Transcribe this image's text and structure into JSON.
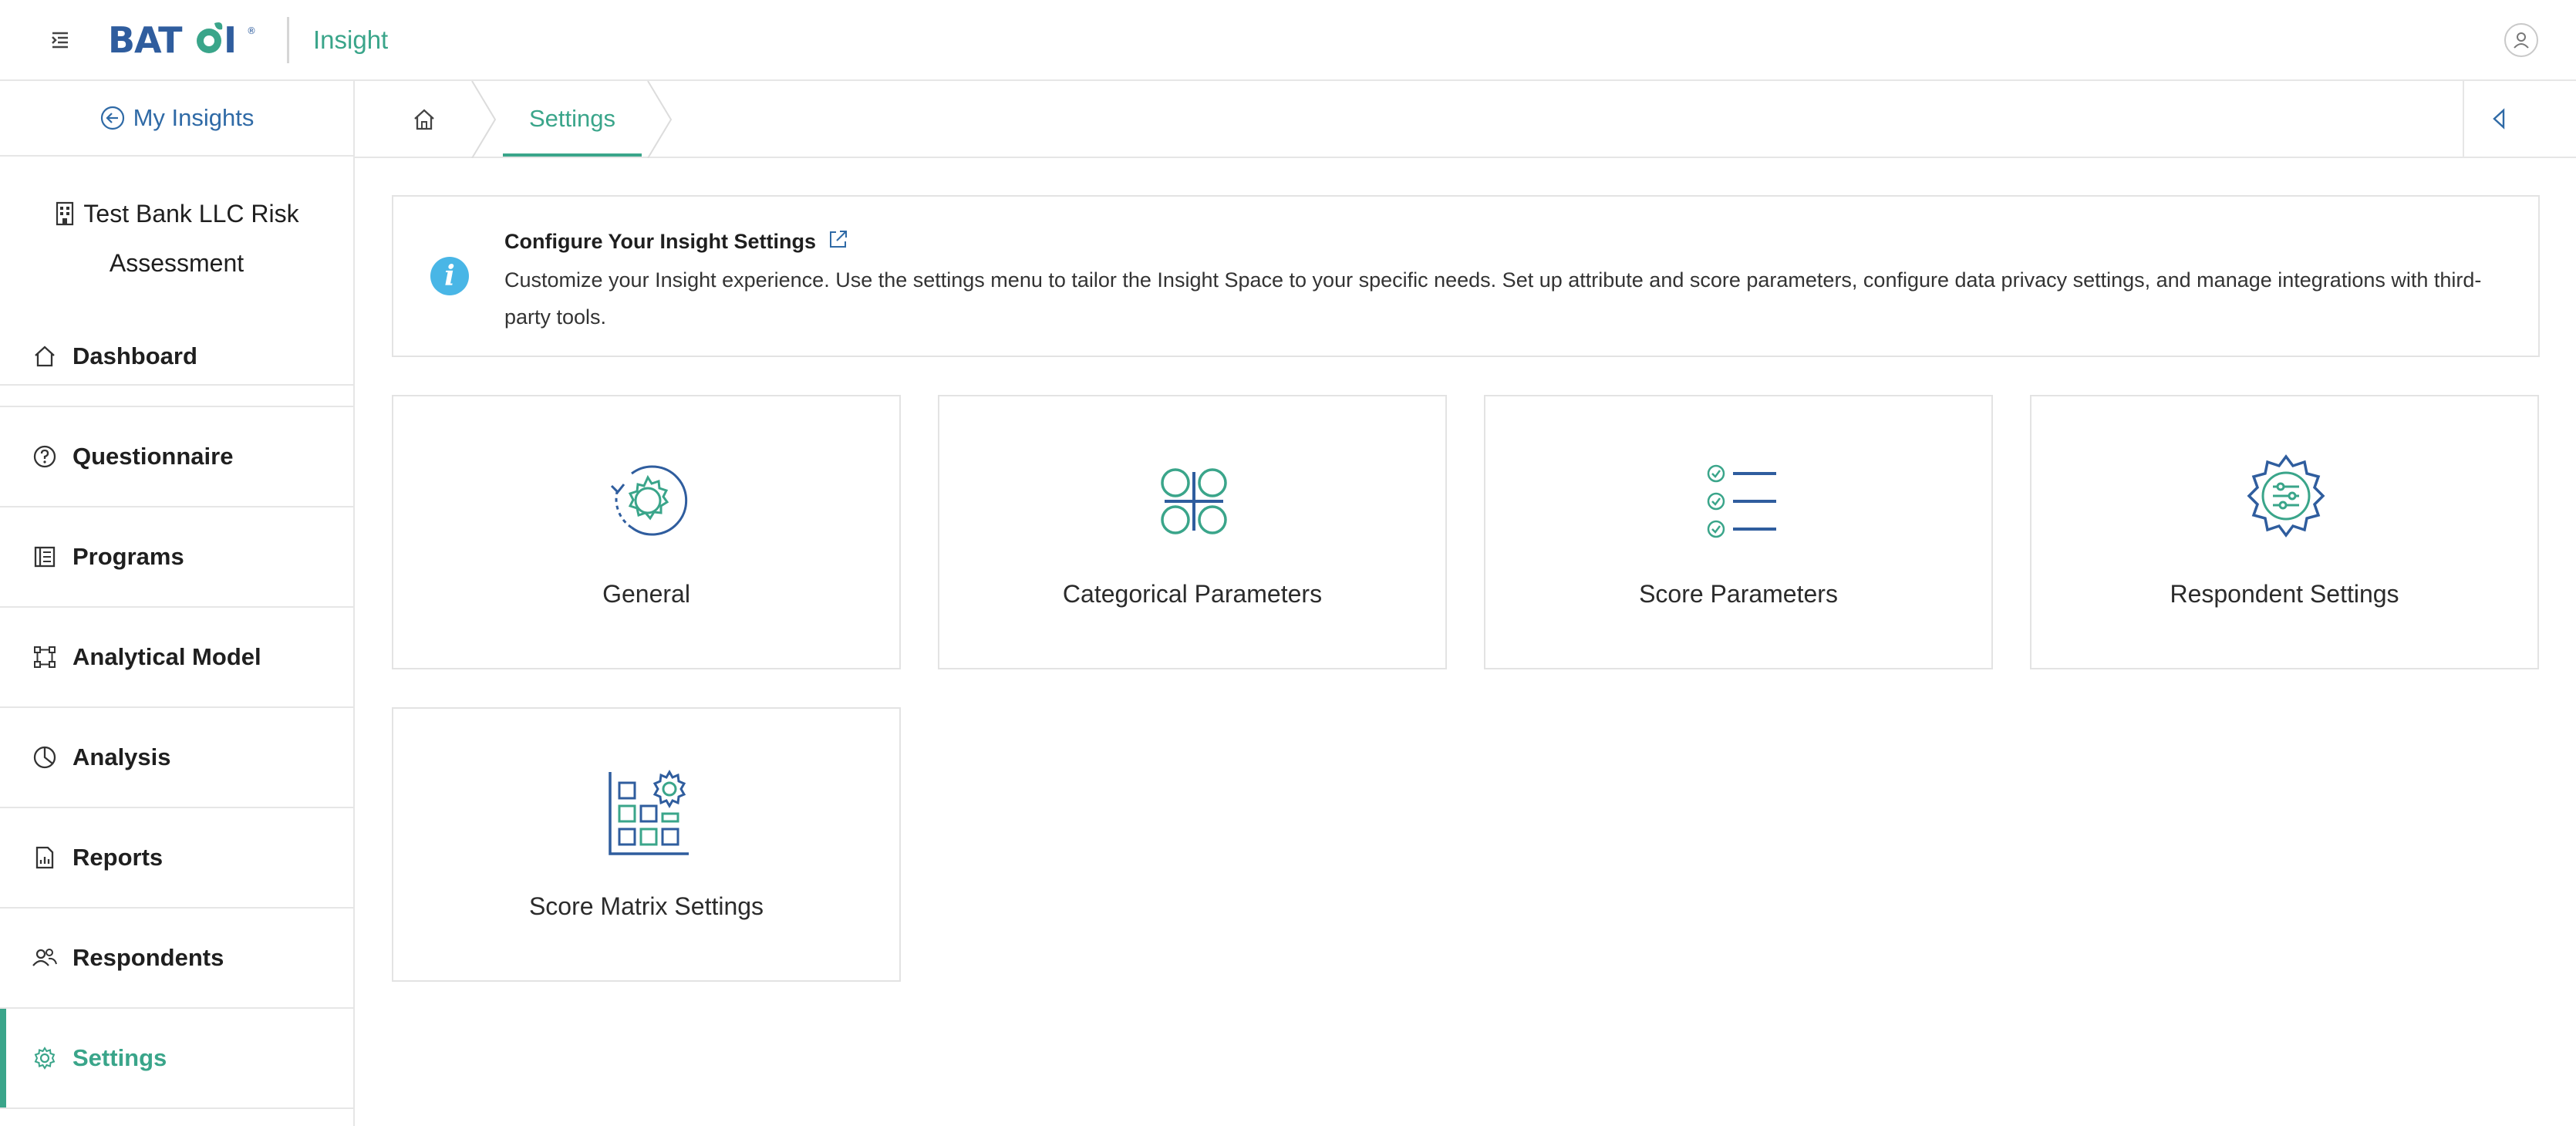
{
  "header": {
    "brand": "BATOI",
    "app_name": "Insight"
  },
  "sidebar": {
    "back_label": "My Insights",
    "workspace_line1": "Test Bank LLC Risk",
    "workspace_line2": "Assessment",
    "items": [
      {
        "label": "Dashboard",
        "icon": "home-icon"
      },
      {
        "label": "Questionnaire",
        "icon": "question-circle-icon"
      },
      {
        "label": "Programs",
        "icon": "list-book-icon"
      },
      {
        "label": "Analytical Model",
        "icon": "nodes-icon"
      },
      {
        "label": "Analysis",
        "icon": "pie-chart-icon"
      },
      {
        "label": "Reports",
        "icon": "report-icon"
      },
      {
        "label": "Respondents",
        "icon": "users-icon"
      },
      {
        "label": "Settings",
        "icon": "gear-icon",
        "active": true
      }
    ]
  },
  "breadcrumb": {
    "home_icon": "home-icon",
    "current": "Settings"
  },
  "info": {
    "title": "Configure Your Insight Settings",
    "description": "Customize your Insight experience. Use the settings menu to tailor the Insight Space to your specific needs. Set up attribute and score parameters, configure data privacy settings, and manage integrations with third-party tools."
  },
  "cards": [
    {
      "label": "General",
      "icon": "gear-refresh-icon"
    },
    {
      "label": "Categorical Parameters",
      "icon": "categories-icon"
    },
    {
      "label": "Score Parameters",
      "icon": "checklist-icon"
    },
    {
      "label": "Respondent Settings",
      "icon": "gear-sliders-icon"
    },
    {
      "label": "Score Matrix Settings",
      "icon": "matrix-gear-icon"
    }
  ],
  "colors": {
    "accent": "#3aa58a",
    "link": "#2f6aa6",
    "icon_blue": "#2f5d9e",
    "info": "#49b6e6"
  }
}
